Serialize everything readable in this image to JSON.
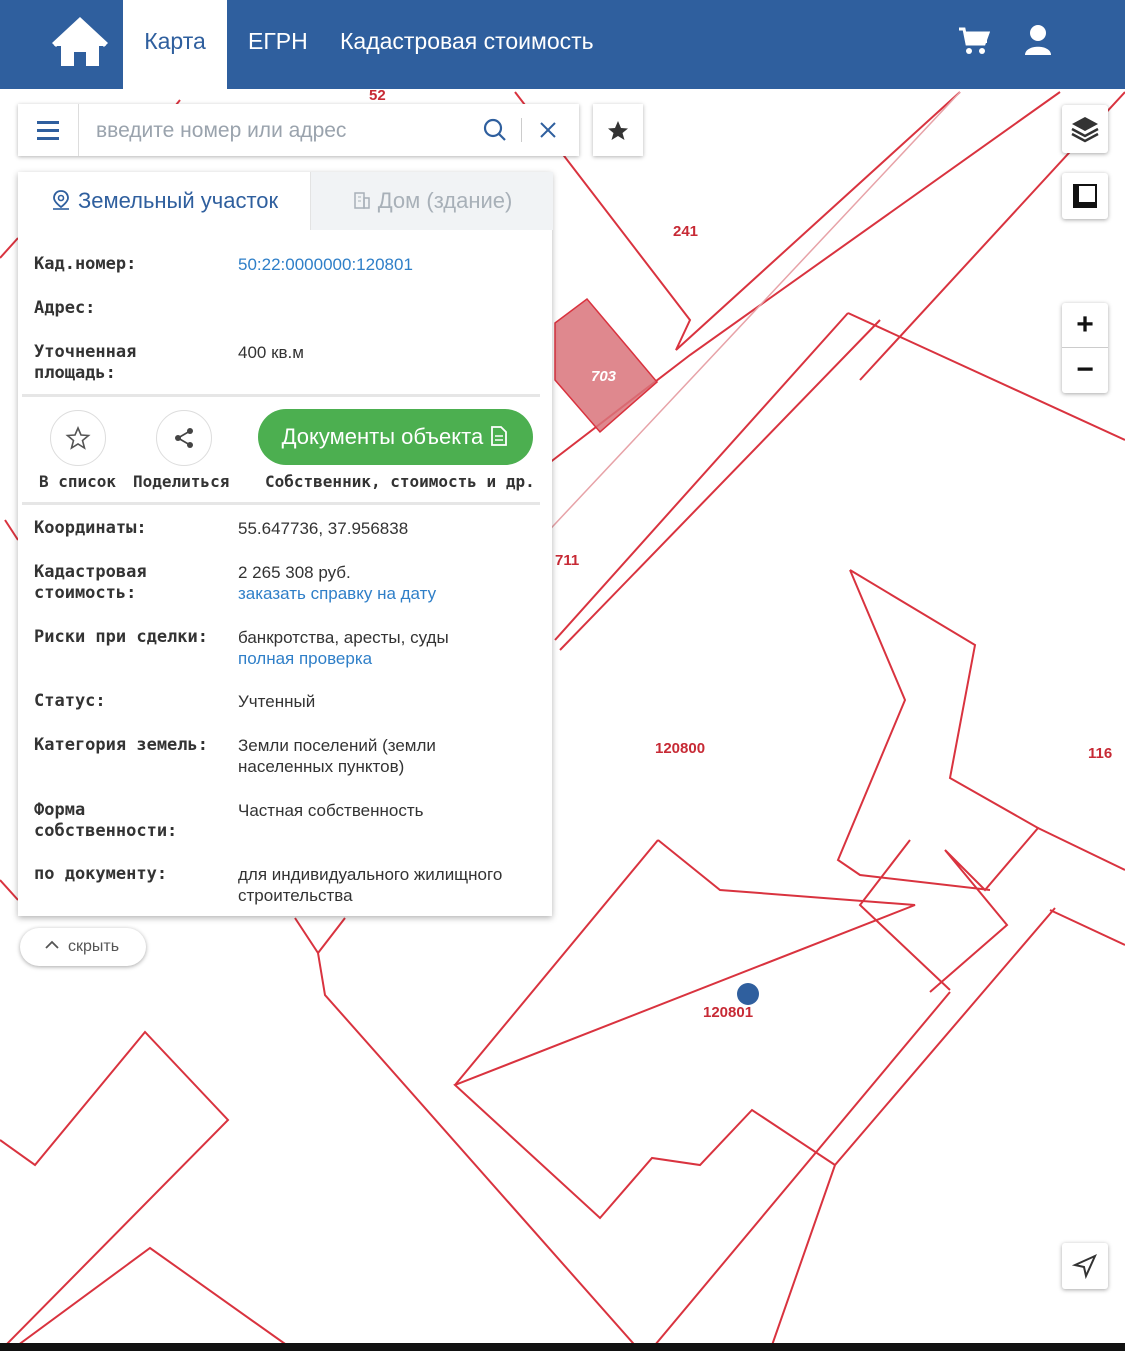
{
  "nav": {
    "tabs": [
      "Карта",
      "ЕГРН",
      "Кадастровая стоимость"
    ],
    "active_tab": "Карта",
    "icons": [
      "home-icon",
      "cart-icon",
      "user-icon"
    ]
  },
  "search": {
    "placeholder": "введите номер или адрес",
    "value": ""
  },
  "map": {
    "labels": {
      "l52": "52",
      "l241": "241",
      "l703": "703",
      "l711": "711",
      "l120800": "120800",
      "l116": "116",
      "l120801": "120801"
    },
    "colors": {
      "boundary": "#d9333f",
      "highlight": "#d9737a",
      "marker": "#2f5f9e"
    }
  },
  "panel": {
    "tab_land": "Земельный участок",
    "tab_house": "Дом (здание)",
    "kad_label": "Кад.номер:",
    "kad_value": "50:22:0000000:120801",
    "address_label": "Адрес:",
    "area_label_1": "Уточненная",
    "area_label_2": "площадь:",
    "area_value": "400 кв.м",
    "action_add": "В список",
    "action_share": "Поделиться",
    "docs_button": "Документы объекта",
    "docs_caption": "Собственник, стоимость и др.",
    "coords_label": "Координаты:",
    "coords_value": "55.647736, 37.956838",
    "cost_label_1": "Кадастровая",
    "cost_label_2": "стоимость:",
    "cost_value": "2 265 308 руб.",
    "cost_link": "заказать справку на дату",
    "risk_label": "Риски при сделки:",
    "risk_value": "банкротства, аресты, суды",
    "risk_link": "полная проверка",
    "status_label": "Статус:",
    "status_value": "Учтенный",
    "cat_label": "Категория земель:",
    "cat_value_1": "Земли поселений (земли",
    "cat_value_2": "населенных пунктов)",
    "form_label_1": "Форма",
    "form_label_2": "собственности:",
    "form_value": "Частная собственность",
    "doc_label": "по документу:",
    "doc_value_1": "для индивидуального жилищного",
    "doc_value_2": "строительства",
    "hide_button": "скрыть"
  },
  "controls": {
    "zoom_in": "+",
    "zoom_out": "−",
    "icons": [
      "layers-icon",
      "measure-icon",
      "locate-icon"
    ]
  }
}
